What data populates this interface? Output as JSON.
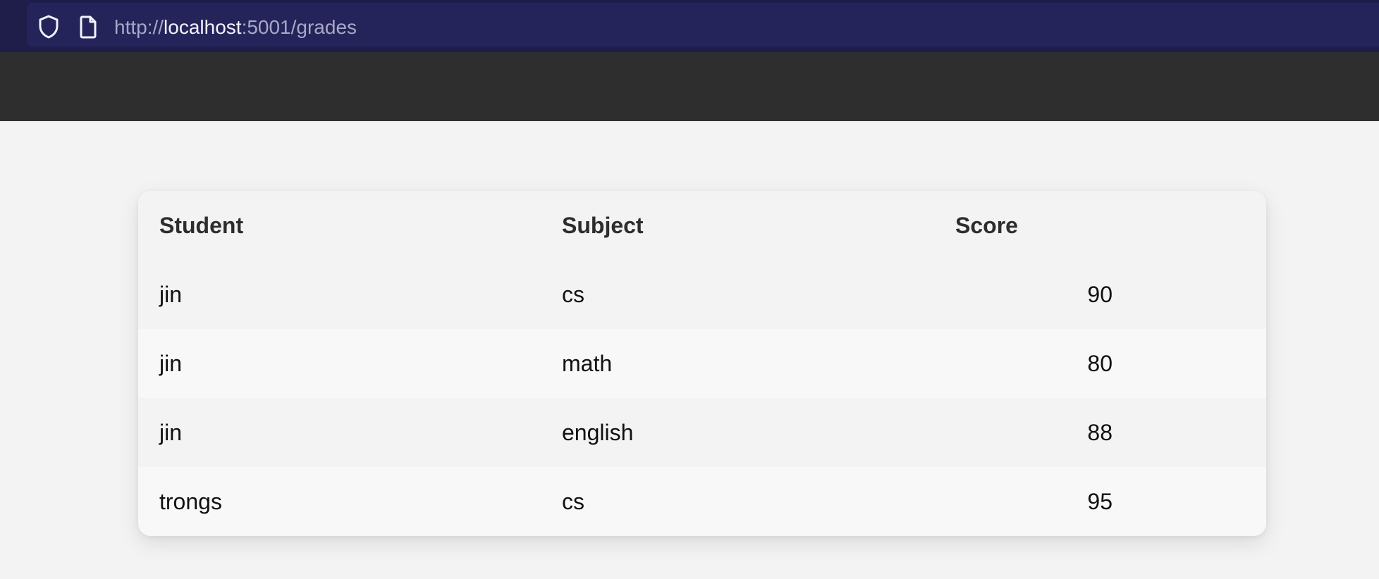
{
  "browser": {
    "url_scheme": "http://",
    "url_host": "localhost",
    "url_rest": ":5001/grades",
    "icons": [
      "shield-icon",
      "page-icon"
    ],
    "colors": {
      "toolbar": "#1f1d4a",
      "urlbar": "#25245a",
      "url_text": "#a9a7c7",
      "url_host": "#f2f2ff"
    }
  },
  "header": {
    "color": "#2e2e2e"
  },
  "table": {
    "columns": [
      "Student",
      "Subject",
      "Score"
    ],
    "rows": [
      {
        "student": "jin",
        "subject": "cs",
        "score": "90"
      },
      {
        "student": "jin",
        "subject": "math",
        "score": "80"
      },
      {
        "student": "jin",
        "subject": "english",
        "score": "88"
      },
      {
        "student": "trongs",
        "subject": "cs",
        "score": "95"
      }
    ]
  }
}
